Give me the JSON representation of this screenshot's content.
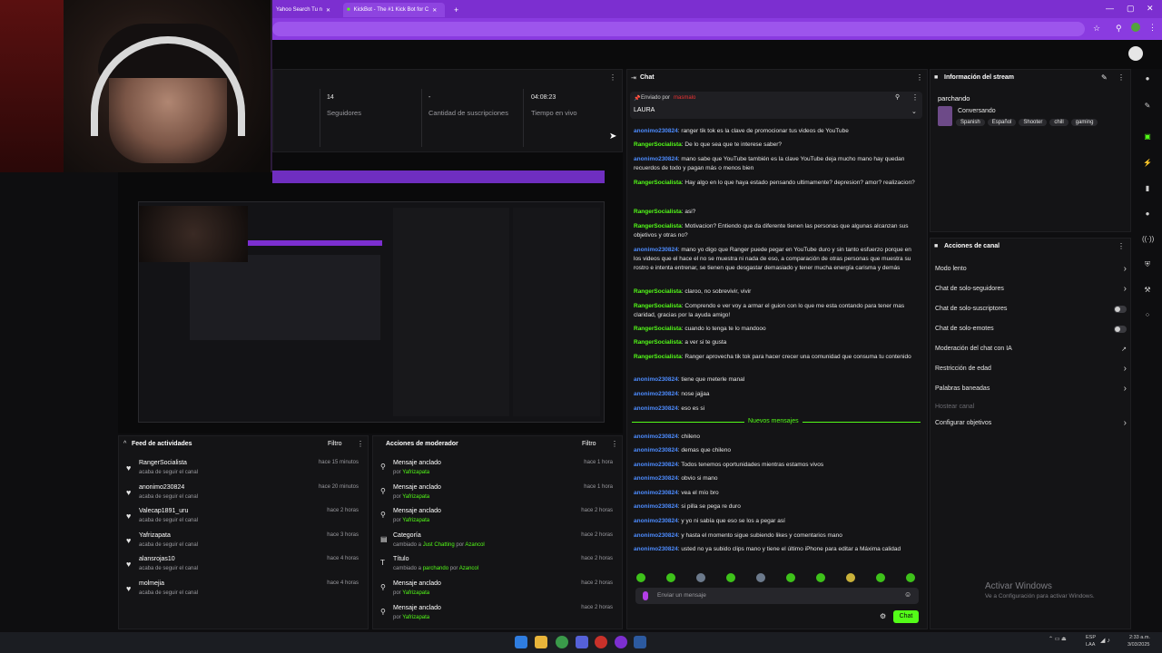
{
  "browser": {
    "tabs": [
      {
        "label": "Yahoo Search Tu n"
      },
      {
        "label": "KickBot - The #1 Kick Bot for C"
      }
    ]
  },
  "stats": [
    {
      "value": "14",
      "label": "Seguidores"
    },
    {
      "value": "-",
      "label": "Cantidad de suscripciones"
    },
    {
      "value": "04:08:23",
      "label": "Tiempo en vivo"
    }
  ],
  "feed": {
    "title": "Feed de actividades",
    "filter": "Filtro",
    "items": [
      {
        "name": "RangerSocialista",
        "sub": "acaba de seguir el canal",
        "time": "hace 15 minutos"
      },
      {
        "name": "anonimo230824",
        "sub": "acaba de seguir el canal",
        "time": "hace 20 minutos"
      },
      {
        "name": "Valecap1891_uru",
        "sub": "acaba de seguir el canal",
        "time": "hace 2 horas"
      },
      {
        "name": "Yafrizapata",
        "sub": "acaba de seguir el canal",
        "time": "hace 3 horas"
      },
      {
        "name": "alansrojas10",
        "sub": "acaba de seguir el canal",
        "time": "hace 4 horas"
      },
      {
        "name": "molmejia",
        "sub": "acaba de seguir el canal",
        "time": "hace 4 horas"
      }
    ]
  },
  "mod": {
    "title": "Acciones de moderador",
    "filter": "Filtro",
    "items": [
      {
        "name": "Mensaje anclado",
        "sub_pre": "por",
        "sub_user": "Yafrizapata",
        "time": "hace 1 hora"
      },
      {
        "name": "Mensaje anclado",
        "sub_pre": "por",
        "sub_user": "Yafrizapata",
        "time": "hace 1 hora"
      },
      {
        "name": "Mensaje anclado",
        "sub_pre": "por",
        "sub_user": "Yafrizapata",
        "time": "hace 2 horas"
      },
      {
        "name": "Categoría",
        "sub_pre": "cambiado a",
        "sub_user": "Just Chatting",
        "sub_post": "por",
        "sub_user2": "Azancol",
        "time": "hace 2 horas"
      },
      {
        "name": "Título",
        "sub_pre": "cambiado a",
        "sub_user": "parchando",
        "sub_post": "por",
        "sub_user2": "Azancol",
        "time": "hace 2 horas"
      },
      {
        "name": "Mensaje anclado",
        "sub_pre": "por",
        "sub_user": "Yafrizapata",
        "time": "hace 2 horas"
      },
      {
        "name": "Mensaje anclado",
        "sub_pre": "por",
        "sub_user": "Yafrizapata",
        "time": "hace 2 horas"
      }
    ]
  },
  "chat": {
    "title": "Chat",
    "pinned_by": "Enviado por",
    "pinned_user": "masmalo",
    "pinned_text": "LAURA",
    "new_messages": "Nuevos mensajes",
    "input_placeholder": "Enviar un mensaje",
    "send_label": "Chat",
    "messages": [
      {
        "user": "anonimo230824",
        "color": "b",
        "text": "ranger tik tok es la clave de promocionar tus videos de YouTube"
      },
      {
        "user": "RangerSocialista",
        "color": "g",
        "text": "De lo que sea que te interese saber?"
      },
      {
        "user": "anonimo230824",
        "color": "b",
        "text": "mano sabe que YouTube también es la clave YouTube deja mucho mano hay quedan recuerdos de todo y pagan más o menos bien"
      },
      {
        "user": "RangerSocialista",
        "color": "g",
        "text": "Hay algo en lo que haya estado pensando ultimamente? depresion? amor? realizacion?"
      },
      {
        "user": "RangerSocialista",
        "color": "g",
        "text": "asi?"
      },
      {
        "user": "RangerSocialista",
        "color": "g",
        "text": "Motivacion? Entiendo que da diferente tienen las personas que algunas alcanzan sus objetivos y otras no?"
      },
      {
        "user": "anonimo230824",
        "color": "b",
        "text": "mano yo digo que Ranger puede pegar en YouTube duro y sin tanto esfuerzo porque en los videos que el hace el no se muestra ni nada de eso, a comparación de otras personas que muestra su rostro e intenta entrenar, se tienen que desgastar demasiado y tener mucha energía carisma y demás"
      },
      {
        "user": "RangerSocialista",
        "color": "g",
        "text": "claroo, no sobrevivir, vivir"
      },
      {
        "user": "RangerSocialista",
        "color": "g",
        "text": "Comprendo e ver voy a armar el guion con lo que me esta contando para tener mas claridad, gracias por la ayuda amigo!"
      },
      {
        "user": "RangerSocialista",
        "color": "g",
        "text": "cuando lo tenga te lo mandooo"
      },
      {
        "user": "RangerSocialista",
        "color": "g",
        "text": "a ver si te gusta"
      },
      {
        "user": "RangerSocialista",
        "color": "g",
        "text": "Ranger aprovecha tik tok para hacer crecer una comunidad que consuma tu contenido"
      },
      {
        "user": "anonimo230824",
        "color": "b",
        "text": "tiene que meterle manal"
      },
      {
        "user": "anonimo230824",
        "color": "b",
        "text": "nose jajjaa"
      },
      {
        "user": "anonimo230824",
        "color": "b",
        "text": "eso es si"
      }
    ],
    "new_list": [
      {
        "user": "anonimo230824",
        "color": "b",
        "text": "chileno"
      },
      {
        "user": "anonimo230824",
        "color": "b",
        "text": "demas que chileno"
      },
      {
        "user": "anonimo230824",
        "color": "b",
        "text": "Todos tenemos oportunidades mientras estamos vivos"
      },
      {
        "user": "anonimo230824",
        "color": "b",
        "text": "obvio si mano"
      },
      {
        "user": "anonimo230824",
        "color": "b",
        "text": "vea el mío bro"
      },
      {
        "user": "anonimo230824",
        "color": "b",
        "text": "si pilla se pega re duro"
      },
      {
        "user": "anonimo230824",
        "color": "b",
        "text": "y yo ni sabía que eso se los a pegar así"
      },
      {
        "user": "anonimo230824",
        "color": "b",
        "text": "y hasta el momento sigue subiendo likes y comentarios mano"
      },
      {
        "user": "anonimo230824",
        "color": "b",
        "text": "usted no ya subido clips mano y tiene el último iPhone para editar a Máxima calidad"
      }
    ]
  },
  "stream_info": {
    "title": "Información del stream",
    "stream_title": "parchando",
    "category": "Conversando",
    "tags": [
      "Spanish",
      "Español",
      "Shooter",
      "chill",
      "gaming"
    ]
  },
  "channel_actions": {
    "title": "Acciones de canal",
    "items": [
      {
        "label": "Modo lento",
        "control": "arrow"
      },
      {
        "label": "Chat de solo-seguidores",
        "control": "arrow"
      },
      {
        "label": "Chat de solo-suscriptores",
        "control": "toggle"
      },
      {
        "label": "Chat de solo-emotes",
        "control": "toggle"
      },
      {
        "label": "Moderación del chat con IA",
        "control": "ext"
      },
      {
        "label": "Restricción de edad",
        "control": "arrow"
      },
      {
        "label": "Palabras baneadas",
        "control": "arrow"
      },
      {
        "label": "Hostear canal",
        "control": "none"
      },
      {
        "label": "Configurar objetivos",
        "control": "arrow"
      }
    ]
  },
  "watermark": {
    "line1": "Activar Windows",
    "line2": "Ve a Configuración para activar Windows."
  },
  "taskbar": {
    "lang": "ESP",
    "lang2": "LAA",
    "time": "2:33 a.m.",
    "date": "3/03/2025"
  },
  "colors": {
    "kick_green": "#53fc18",
    "browser_purple": "#7c2fd0",
    "bg": "#0e0e10"
  }
}
